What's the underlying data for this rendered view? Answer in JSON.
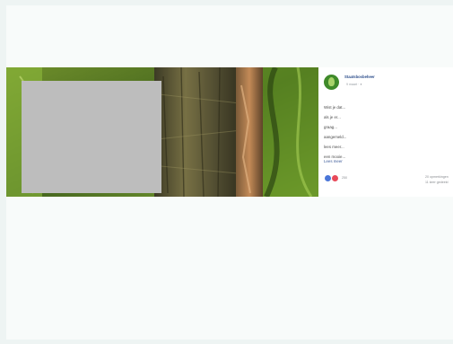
{
  "post": {
    "page_name": "Staatsbosbeheer",
    "meta": "9 maart · ●",
    "text_lines": [
      "Wist je dat...",
      "als je er...",
      "graag...",
      "aangemeld...",
      "lees meer...",
      "een mooie..."
    ],
    "link_text": "Lees meer",
    "reaction_count": "250",
    "comments": "20 opmerkingen",
    "shares": "11 keer gedeeld"
  },
  "colors": {
    "background": "#eef4f3",
    "card": "#f8fbfa",
    "redaction": "#bdbdbd",
    "brand_green": "#3f8a2a",
    "link_blue": "#2e4f8c"
  },
  "icons": {
    "avatar": "tree-logo-icon",
    "like": "like-reaction-icon",
    "love": "love-reaction-icon"
  }
}
